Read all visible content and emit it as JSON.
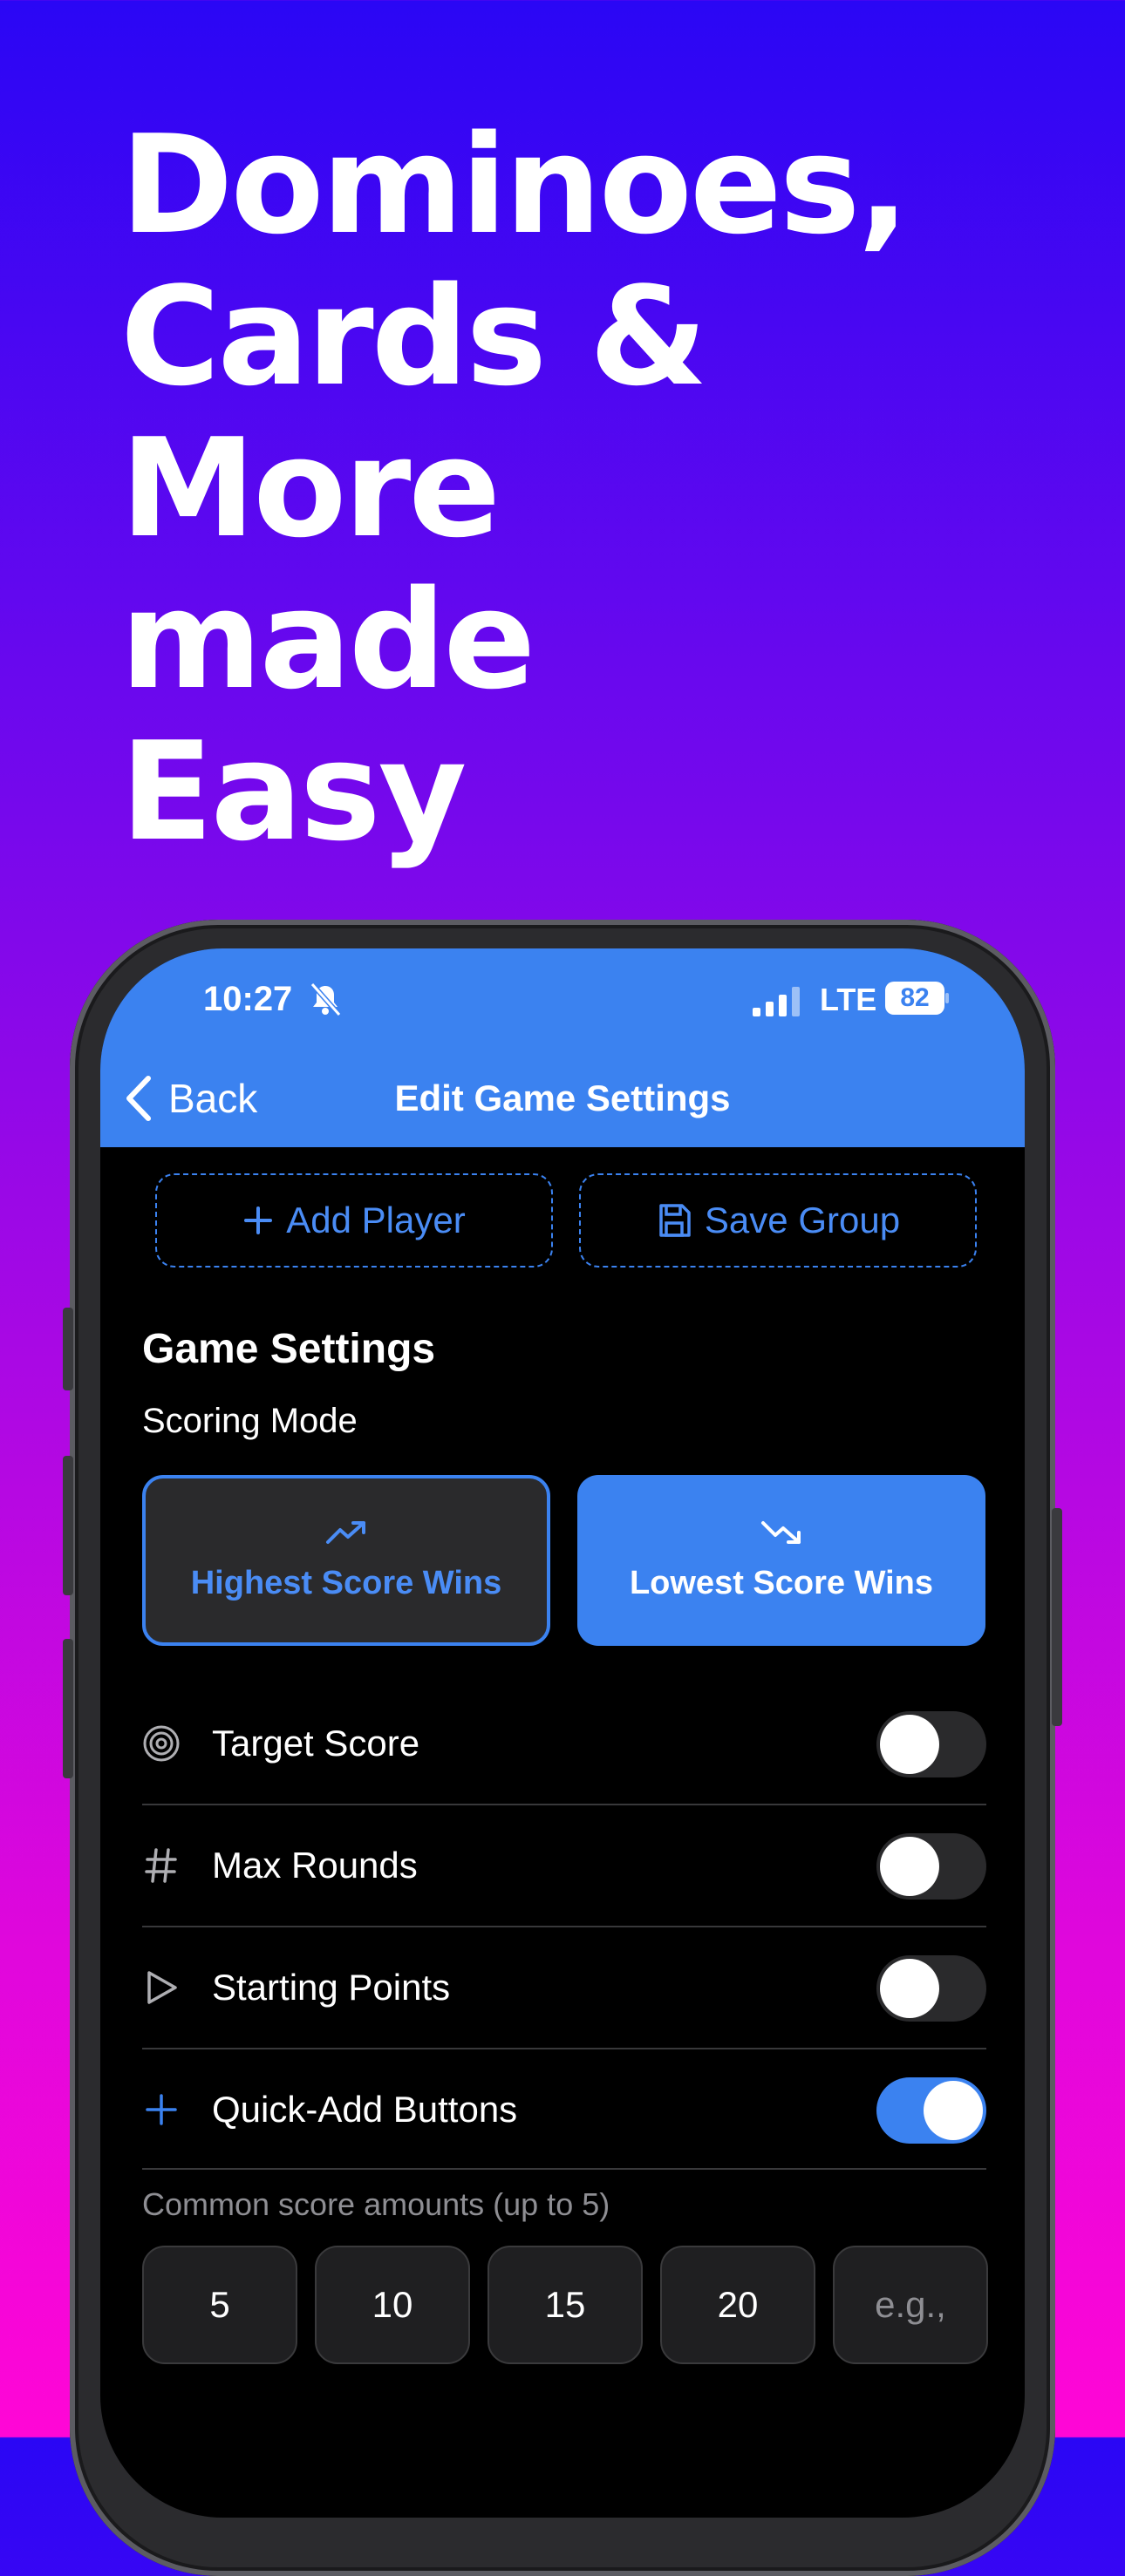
{
  "headline": [
    "Dominoes,",
    "Cards &",
    "More",
    "made",
    "Easy"
  ],
  "status_bar": {
    "time": "10:27",
    "network": "LTE",
    "battery": "82"
  },
  "nav": {
    "back_label": "Back",
    "title": "Edit Game Settings"
  },
  "actions": {
    "add_player": "Add Player",
    "save_group": "Save Group"
  },
  "settings": {
    "title": "Game Settings",
    "scoring_mode_label": "Scoring Mode",
    "modes": [
      {
        "label": "Highest Score Wins",
        "icon": "trending-up-icon",
        "selected": false
      },
      {
        "label": "Lowest Score Wins",
        "icon": "trending-down-icon",
        "selected": true
      }
    ],
    "rows": [
      {
        "label": "Target Score",
        "icon": "target-icon",
        "enabled": false
      },
      {
        "label": "Max Rounds",
        "icon": "hash-icon",
        "enabled": false
      },
      {
        "label": "Starting Points",
        "icon": "play-icon",
        "enabled": false
      },
      {
        "label": "Quick-Add Buttons",
        "icon": "plus-icon",
        "enabled": true
      }
    ],
    "quick_add_hint": "Common score amounts (up to 5)",
    "quick_add_values": [
      "5",
      "10",
      "15",
      "20"
    ],
    "quick_add_placeholder": "e.g.,"
  },
  "colors": {
    "accent": "#3b82f0",
    "background_top": "#2a06f5",
    "background_bottom": "#ff06d6"
  }
}
